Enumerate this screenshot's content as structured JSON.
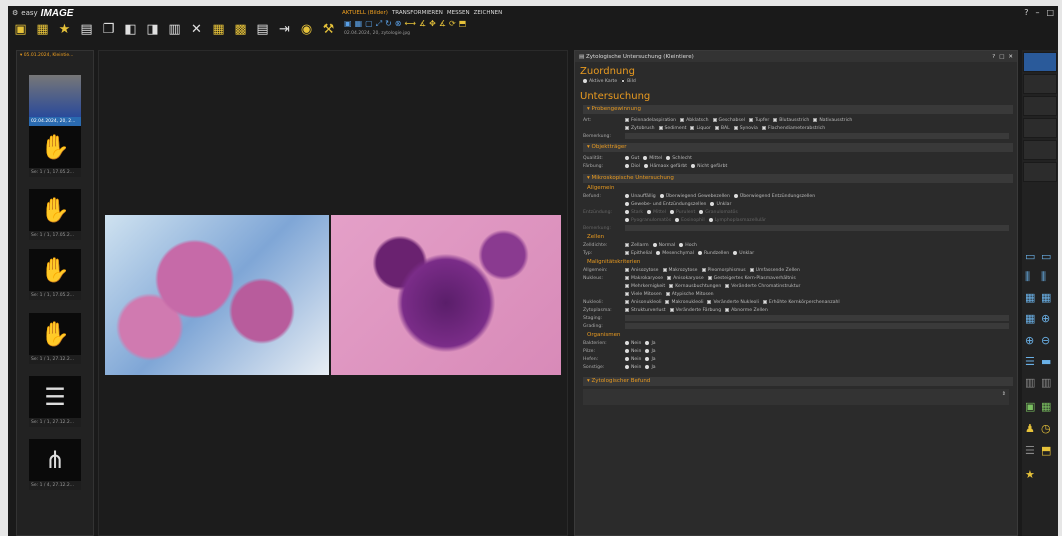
{
  "app": {
    "logo_text": "easy",
    "brand": "IMAGE",
    "logo_icon": "gear-icon"
  },
  "window_controls": [
    "?",
    "–",
    "□"
  ],
  "menu_tabs": [
    {
      "label": "AKTUELL (Bilder)",
      "active": true
    },
    {
      "label": "TRANSFORMIEREN"
    },
    {
      "label": "MESSEN"
    },
    {
      "label": "ZEICHNEN"
    }
  ],
  "toolbar_icons": [
    "image-save-icon",
    "image-export-icon",
    "image-star-icon",
    "scanner-icon",
    "image-copy-icon",
    "copy-icon",
    "paste-icon",
    "save-icon",
    "delete-icon",
    "gallery-icon",
    "image-add-icon",
    "print-icon",
    "import-icon",
    "settings-image-icon",
    "tools-icon"
  ],
  "sub_toolbar_icons": [
    "overview-icon",
    "image-grid-icon",
    "image-icon",
    "select-icon",
    "refresh-icon",
    "zoom-icon",
    "ruler-icon",
    "angle-icon",
    "move-icon",
    "measure-icon",
    "rotate-icon",
    "tag-icon"
  ],
  "current_file": "02.04.2024, 20, zytologie.jpg",
  "left_panel": {
    "header": "▾ 05.01.2024, Kleintie...",
    "thumbs": [
      {
        "label": "02.04.2024, 20, 2...",
        "selected": true,
        "icon": "cytology-thumb-icon"
      },
      {
        "label": "Se: 1 / 1, 17.05.2...",
        "icon": "xray-hand-icon"
      },
      {
        "label": "Se: 1 / 1, 17.05.2...",
        "icon": "xray-hand-icon"
      },
      {
        "label": "Se: 1 / 1, 17.05.2...",
        "icon": "xray-hand-icon"
      },
      {
        "label": "Se: 1 / 1, 27.12.2...",
        "icon": "xray-hand-icon"
      },
      {
        "label": "Se: 1 / 1, 27.12.2...",
        "icon": "xray-spine-icon"
      },
      {
        "label": "Se: 1 / 4, 27.12.2...",
        "icon": "xray-legs-icon"
      }
    ]
  },
  "form": {
    "title": "Zytologische Untersuchung (Kleintiere)",
    "title_icon": "document-icon",
    "controls": [
      "?",
      "□",
      "✕"
    ],
    "zuordnung": {
      "heading": "Zuordnung",
      "options": [
        {
          "label": "Aktive Karte",
          "on": false
        },
        {
          "label": "Bild",
          "on": true
        }
      ]
    },
    "untersuchung": "Untersuchung",
    "probengewinnung": {
      "heading": "▾ Probengewinnung",
      "art_label": "Art:",
      "art_row1": [
        "Feinnadelaspiration",
        "Abklatsch",
        "Geschabsel",
        "Tupfer",
        "Blutausstrich",
        "Nativausstrich"
      ],
      "art_row2": [
        "Zytobrush",
        "Sediment",
        "Liquor",
        "BAL",
        "Synovia",
        "Flachendiameterabstrich"
      ],
      "bemerkung": "Bemerkung:"
    },
    "objekttraeger": {
      "heading": "▾ Objektträger",
      "qualitaet_label": "Qualität:",
      "qualitaet": [
        "Gut",
        "Mittel",
        "Schlecht"
      ],
      "faerbung_label": "Färbung:",
      "faerbung": [
        "Diol",
        "Hämaox gefärbt",
        "Nicht gefärbt"
      ]
    },
    "mikroskopisch": {
      "heading": "▾ Mikroskopische Untersuchung",
      "allgemein": "Allgemein",
      "befund_label": "Befund:",
      "befund_row1": [
        "Unauffällig",
        "Überwiegend Gewebezellen",
        "Überwiegend Entzündungszellen"
      ],
      "befund_row2": [
        "Gewebe- und Entzündungszellen",
        "Unklar"
      ],
      "entz_label": "Entzündung:",
      "entz_row1": [
        "Stark",
        "Mittel",
        "Purulent",
        "Granulomatös"
      ],
      "entz_row2": [
        "Pyogranulomatös",
        "Eosinophil",
        "Lymphoplasmazellulär"
      ],
      "bem_label": "Bemerkung:",
      "zellen": "Zellen",
      "zell_label": "Zelldichte:",
      "zell": [
        "Zellarm",
        "Normal",
        "Hoch"
      ],
      "typ_label": "Typ:",
      "typ": [
        "Epithelial",
        "Mesenchymal",
        "Rundzellen",
        "Unklar"
      ],
      "malign": "Malignitätskriterien",
      "allg_label": "Allgemein:",
      "allg_row1": [
        "Anisozytose",
        "Makrozytose",
        "Pleomorphismus",
        "Umfassende Zellen"
      ],
      "nukleus_label": "Nukleus:",
      "nuk_row1": [
        "Makrokaryose",
        "Anisokaryose",
        "Gesteigertes Kern-Plasmaverhältnis"
      ],
      "nuk_row2": [
        "Mehrkernigkeit",
        "Kernausbuchtungen",
        "Veränderte Chromatinstruktur"
      ],
      "nuk_row3": [
        "Viele Mitosen",
        "Atypische Mitosen"
      ],
      "nukleoli_label": "Nukleoli:",
      "nukleoli_row": [
        "Anisonukleoli",
        "Makronukleoli",
        "Veränderte Nukleoli",
        "Erhöhte Kernkörperchenanzahl"
      ],
      "zyto_label": "Zytoplasma:",
      "zyto_row": [
        "Strukturverlust",
        "Veränderte Färbung",
        "Abnorme Zellen"
      ],
      "staging_label": "Staging:",
      "grading_label": "Grading:",
      "org": "Organismen",
      "org_rows": [
        {
          "label": "Bakterien:",
          "opts": [
            "Nein",
            "Ja"
          ]
        },
        {
          "label": "Pilze:",
          "opts": [
            "Nein",
            "Ja"
          ]
        },
        {
          "label": "Hefen:",
          "opts": [
            "Nein",
            "Ja"
          ]
        },
        {
          "label": "Sonstige:",
          "opts": [
            "Nein",
            "Ja"
          ]
        }
      ]
    },
    "zytologischer_befund": "▾ Zytologischer Befund"
  },
  "right_tools": [
    "layout-1-icon",
    "layout-2-icon",
    "layout-3-icon",
    "layout-4-icon",
    "layout-5-icon",
    "layout-6-icon",
    "zoom-in-icon",
    "zoom-out-icon",
    "list-view-icon",
    "grid-view-icon",
    "columns-icon",
    "export-icon",
    "gallery-icon",
    "clock-icon",
    "tag-icon",
    "image-star-icon"
  ]
}
